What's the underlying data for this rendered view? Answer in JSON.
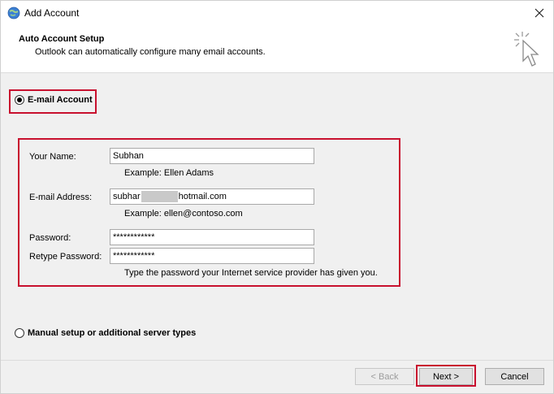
{
  "window": {
    "title": "Add Account"
  },
  "header": {
    "title": "Auto Account Setup",
    "subtitle": "Outlook can automatically configure many email accounts."
  },
  "email_account": {
    "label": "E-mail Account",
    "selected": true,
    "fields": {
      "name": {
        "label": "Your Name:",
        "value": "Subhan",
        "example": "Example: Ellen Adams"
      },
      "email": {
        "label": "E-mail Address:",
        "value_start": "subhar",
        "value_end": "hotmail.com",
        "example": "Example: ellen@contoso.com"
      },
      "password": {
        "label": "Password:",
        "value": "************"
      },
      "retype_password": {
        "label": "Retype Password:",
        "value": "************"
      },
      "password_hint": "Type the password your Internet service provider has given you."
    }
  },
  "manual_setup": {
    "label": "Manual setup or additional server types",
    "selected": false
  },
  "buttons": {
    "back": "< Back",
    "next": "Next >",
    "cancel": "Cancel"
  },
  "colors": {
    "highlight": "#c8102e",
    "background": "#f0f0f0"
  }
}
